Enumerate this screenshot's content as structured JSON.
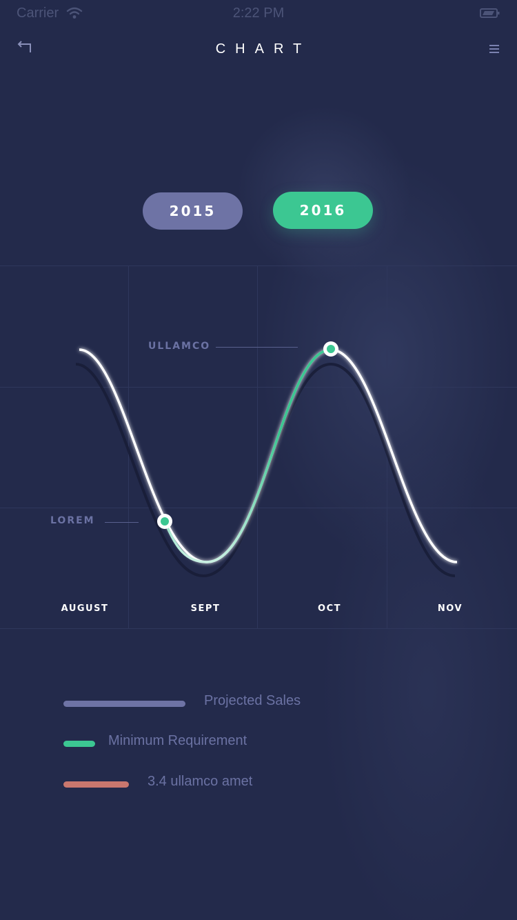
{
  "status_bar": {
    "carrier": "Carrier",
    "time": "2:22 PM"
  },
  "nav": {
    "title": "CHART",
    "back_icon": "back-arrow-icon",
    "menu_icon": "hamburger-menu-icon"
  },
  "year_toggle": {
    "options": [
      "2015",
      "2016"
    ],
    "selected": "2016"
  },
  "colors": {
    "background": "#232a4b",
    "projected": "#6e73a5",
    "minimum": "#3cc792",
    "ullamco": "#c9776e",
    "label": "#6b72a3"
  },
  "chart_data": {
    "type": "line",
    "categories": [
      "AUGUST",
      "SEPT",
      "OCT",
      "NOV"
    ],
    "annotations": [
      {
        "label": "ULLAMCO",
        "x": "OCT"
      },
      {
        "label": "LOREM",
        "x": "SEPT"
      }
    ],
    "grid": true
  },
  "chart_labels": {
    "ullamco": "ULLAMCO",
    "lorem": "LOREM"
  },
  "legend": [
    {
      "label": "Projected Sales",
      "color": "#6e73a5"
    },
    {
      "label": "Minimum Requirement",
      "color": "#3cc792"
    },
    {
      "label": "3.4 ullamco amet",
      "color": "#c9776e"
    }
  ]
}
